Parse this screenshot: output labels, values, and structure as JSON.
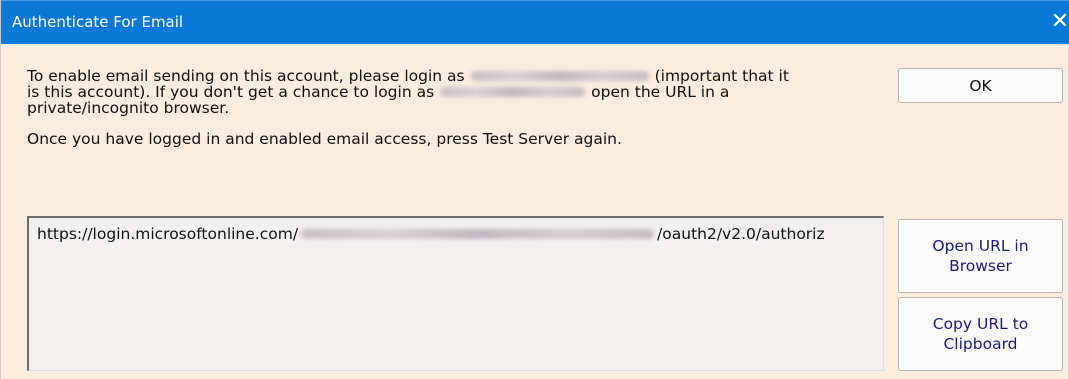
{
  "window": {
    "title": "Authenticate For Email",
    "close_glyph": "✕"
  },
  "message": {
    "line1_a": "To enable email sending on this account, please login as",
    "line1_b": "(important that it",
    "line2_a": "is this account).  If you don't get a chance to login as",
    "line2_b": "open the URL in a",
    "line3": "private/incognito browser.",
    "line4": "Once you have logged in and enabled email access, press Test Server again."
  },
  "url_field": {
    "prefix": "https://login.microsoftonline.com/",
    "suffix": "/oauth2/v2.0/authoriz"
  },
  "buttons": {
    "ok": "OK",
    "open_line1": "Open URL in",
    "open_line2": "Browser",
    "copy_line1": "Copy URL to",
    "copy_line2": "Clipboard"
  },
  "colors": {
    "titlebar": "#0a78d7",
    "dialog_bg": "#faecdf",
    "button_text": "#1b1b82"
  }
}
